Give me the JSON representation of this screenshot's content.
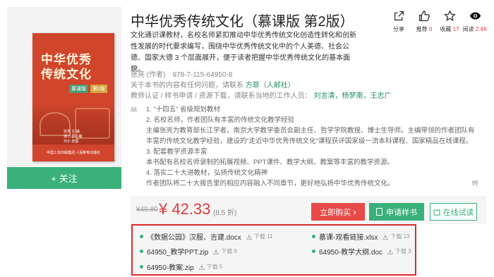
{
  "book": {
    "title": "中华优秀传统文化（慕课版 第2版）",
    "description": "文化通识课教材，名校名师紧扣推动中华优秀传统文化创造性转化和创新性发展的时代要求编写，围绕中华优秀传统文化中的个人美德、社会公德、国家大德 3 个层面展开，便于读者把握中华优秀传统文化的基本面貌。",
    "author": "张亮 (作者)",
    "isbn": "978-7-115-64950-8",
    "editor_prefix": "关于本书的内容有任何问题，请联系 ",
    "editor_link": "方菲（人邮社）",
    "contact_prefix": "教师认证 / 样书申请 / 资源下载，请联系当地的工作人员： ",
    "contact_link": "刘言清，杨梦南，王志广",
    "cover": {
      "title_line1": "中华优秀",
      "title_line2": "传统文化",
      "edition1": "慕课版",
      "edition2": "第2版",
      "authors": "张亮 主 编\n谭力 副主编\n刘小 张蓉",
      "publisher": "中国工信出版集团  人民邮电出版社"
    }
  },
  "follow_label": "+ 关注",
  "actions": [
    {
      "icon": "share-icon",
      "label": "分享",
      "count": ""
    },
    {
      "icon": "thumbs-up-icon",
      "label": "推荐",
      "count": "0"
    },
    {
      "icon": "star-icon",
      "label": "收藏",
      "count": "17"
    },
    {
      "icon": "eye-icon",
      "label": "阅读",
      "count": "2.4K"
    }
  ],
  "features": [
    "1. “十四五” 省级规划教材",
    "2. 名校名师，作者团队有丰富的传统文化教学经验",
    "主编张亮为教育部长江学者，南京大学教学委员会副主任、哲学学院教授、博士生导师。主编带领的作者团队有丰富的传统文化教学经验，建设的“走近中华优秀传统文化”课程获评国家级一流本科课程、国家精品在线课程。",
    "3. 配套教学资源丰富",
    "本书配有名校名师录制的拓展视频、PPT课件、教学大纲、教案等丰富的教学资源。",
    "4. 落实二十大进教材，弘扬传统文化精神",
    "作者团队将二十大报告里的相应内容融入不同章节，更好地弘扬中华优秀传统文化。"
  ],
  "price": {
    "old": "¥49.80",
    "current": "¥ 42.33",
    "discount": "(8.5 折)",
    "buy_label": "立即购买",
    "buy_arrow": "›",
    "sample_label": "申请样书",
    "trial_label": "在线试读"
  },
  "resources": [
    {
      "name": "《数据公园》汉服、吉建.docx",
      "downloads": "下载 11"
    },
    {
      "name": "慕课-观看链接.xlsx",
      "downloads": "下载 13"
    },
    {
      "name": "64950_教学PPT.zip",
      "downloads": "下载 9"
    },
    {
      "name": "64950-教学大纲.doc",
      "downloads": "下载 3"
    },
    {
      "name": "64950-教案.zip",
      "downloads": "下载 5"
    }
  ],
  "colors": {
    "accent_green": "#3ab07a",
    "price_red": "#e03b3b",
    "highlight_border": "#e0282a"
  }
}
